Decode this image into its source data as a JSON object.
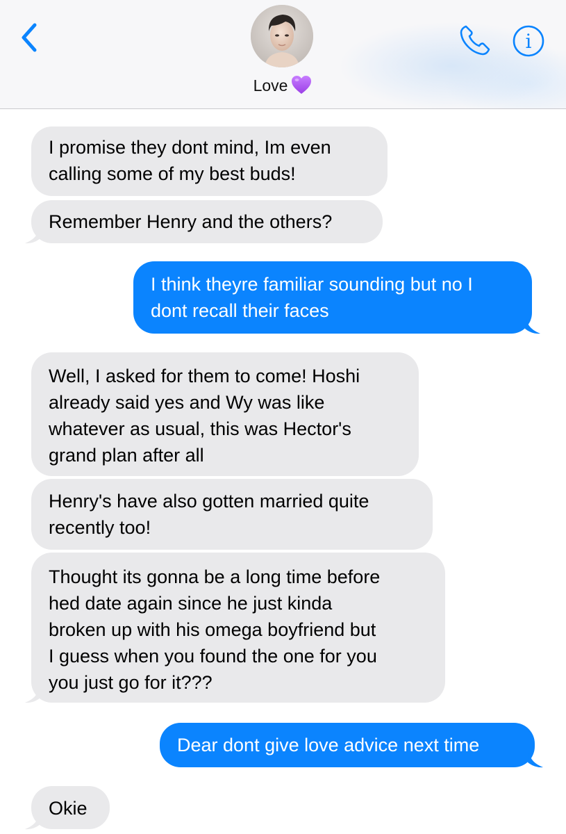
{
  "header": {
    "contact_name": "Love",
    "contact_emoji": "purple-heart",
    "back_icon": "chevron-left-icon",
    "call_icon": "phone-icon",
    "info_icon": "info-icon",
    "accent_color": "#0b84fe"
  },
  "messages": [
    {
      "direction": "incoming",
      "lines": [
        "I promise they dont mind, Im even",
        "calling some of my best buds!"
      ]
    },
    {
      "direction": "incoming",
      "lines": [
        "Remember Henry and the others?"
      ]
    },
    {
      "direction": "outgoing",
      "lines": [
        "I think theyre familiar sounding but no I",
        "dont recall their faces"
      ]
    },
    {
      "direction": "incoming",
      "lines": [
        "Well, I asked for them to come! Hoshi",
        "already said yes and Wy was like",
        "whatever as usual, this was Hector's",
        "grand plan after all"
      ]
    },
    {
      "direction": "incoming",
      "lines": [
        "Henry's have also gotten married quite",
        "recently too!"
      ]
    },
    {
      "direction": "incoming",
      "lines": [
        "Thought its gonna be a long time before",
        "hed date again since he just kinda",
        "broken up with his omega boyfriend but",
        "I guess when you found the one for you",
        "you just go for it???"
      ]
    },
    {
      "direction": "outgoing",
      "lines": [
        "Dear dont give love advice next time"
      ]
    },
    {
      "direction": "incoming",
      "lines": [
        "Okie"
      ]
    }
  ],
  "colors": {
    "incoming_bubble": "#e9e9eb",
    "outgoing_bubble": "#0b84fe",
    "outgoing_text": "#ffffff",
    "incoming_text": "#000000"
  }
}
